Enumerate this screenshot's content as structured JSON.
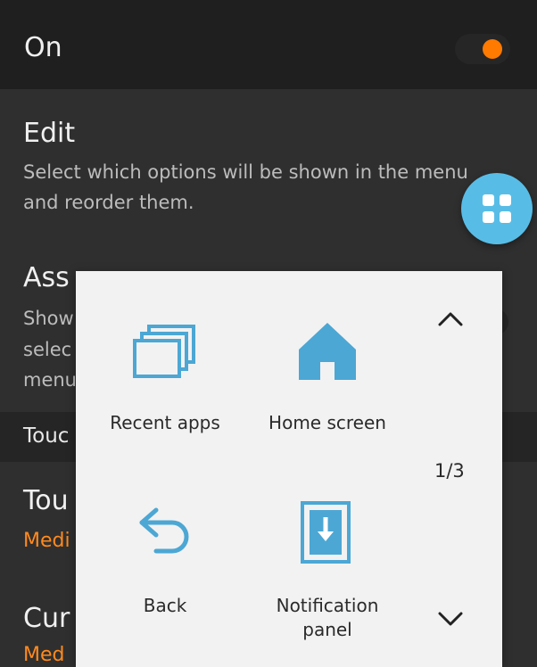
{
  "toggle_row": {
    "label": "On",
    "on": true,
    "accent_color": "#ff7a00"
  },
  "settings": {
    "edit": {
      "title": "Edit",
      "description": "Select which options will be shown in the menu and reorder them."
    },
    "assistant_plus": {
      "title": "Ass",
      "description_lines": [
        "Show",
        "selec",
        "menu"
      ]
    },
    "section_header": "Touc",
    "touchpad_size": {
      "title": "Tou",
      "value": "Medi"
    },
    "cursor_speed": {
      "title": "Cur",
      "value": "Med"
    }
  },
  "fab": {
    "icon": "grid-icon",
    "color": "#58bde6"
  },
  "assistant_menu": {
    "items": [
      {
        "label": "Recent apps",
        "icon": "recent-apps-icon"
      },
      {
        "label": "Home screen",
        "icon": "home-icon"
      },
      {
        "label": "Back",
        "icon": "back-icon"
      },
      {
        "label": "Notification panel",
        "icon": "notification-panel-icon"
      }
    ],
    "page_indicator": "1/3",
    "up_icon": "chevron-up-icon",
    "down_icon": "chevron-down-icon",
    "icon_color": "#4ca7d4"
  }
}
